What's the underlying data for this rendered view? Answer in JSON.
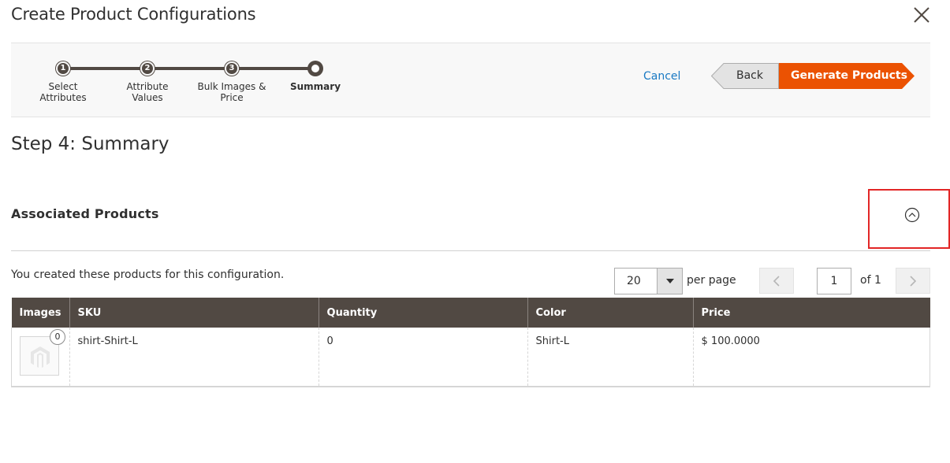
{
  "modal": {
    "title": "Create Product Configurations"
  },
  "wizard": {
    "steps": [
      {
        "number": "1",
        "label_line1": "Select",
        "label_line2": "Attributes"
      },
      {
        "number": "2",
        "label_line1": "Attribute",
        "label_line2": "Values"
      },
      {
        "number": "3",
        "label_line1": "Bulk Images &",
        "label_line2": "Price"
      },
      {
        "number": "",
        "label_line1": "Summary",
        "label_line2": ""
      }
    ],
    "current_step": 4,
    "cancel_label": "Cancel",
    "back_label": "Back",
    "generate_label": "Generate Products"
  },
  "page": {
    "step_title": "Step 4: Summary"
  },
  "associated": {
    "title": "Associated Products",
    "info_text": "You created these products for this configuration.",
    "per_page_value": "20",
    "per_page_label": "per page",
    "current_page": "1",
    "total_pages_label": "of 1",
    "columns": [
      "Images",
      "SKU",
      "Quantity",
      "Color",
      "Price"
    ],
    "rows": [
      {
        "image_count": "0",
        "sku": "shirt-Shirt-L",
        "quantity": "0",
        "color": "Shirt-L",
        "price": "$ 100.0000"
      }
    ]
  },
  "colors": {
    "accent": "#eb5202",
    "header_dark": "#514943",
    "link": "#1979c3",
    "highlight": "#e22626"
  }
}
